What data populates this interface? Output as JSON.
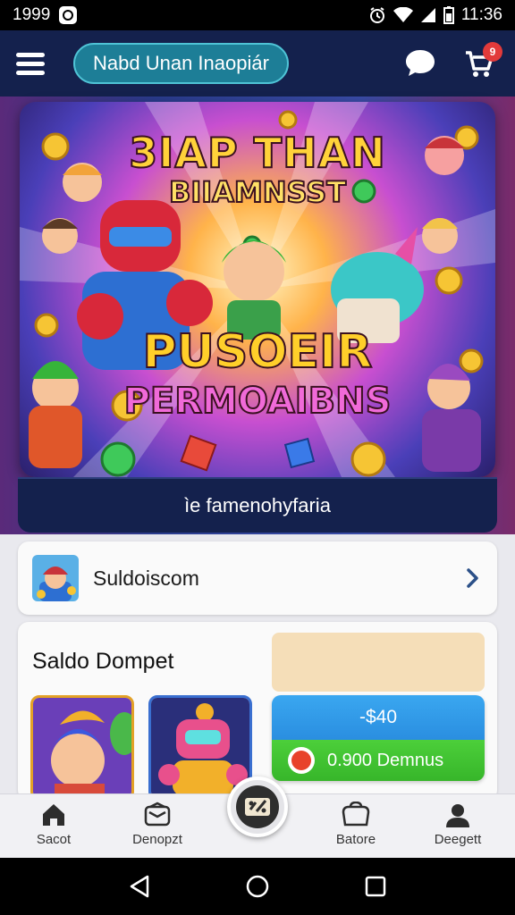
{
  "status_bar": {
    "time_left": "1999",
    "time_right": "11:36"
  },
  "header": {
    "title": "Nabd Unan Inaopiár",
    "cart_badge": "9"
  },
  "hero": {
    "headline_1": "3IAP THAN",
    "headline_2": "BIIAMNSST",
    "headline_3": "PUSOEIR",
    "headline_4": "PERMOAIBNS",
    "caption": "ìe famenohyfaria"
  },
  "list_row": {
    "label": "Suldoiscom"
  },
  "wallet": {
    "title": "Saldo Dompet",
    "balance_top": "-$40",
    "balance_bottom": "0.900 Demnus"
  },
  "bottom_nav": {
    "home_label": "Sacot",
    "deposit_label": "Denopzt",
    "store_label": "Batore",
    "account_label": "Deegett"
  },
  "colors": {
    "header_bg": "#14214d",
    "pill_bg": "#1d7e97",
    "balance_blue": "#3aa7f0",
    "balance_green": "#4ccf3a",
    "badge_red": "#e23a3a"
  }
}
